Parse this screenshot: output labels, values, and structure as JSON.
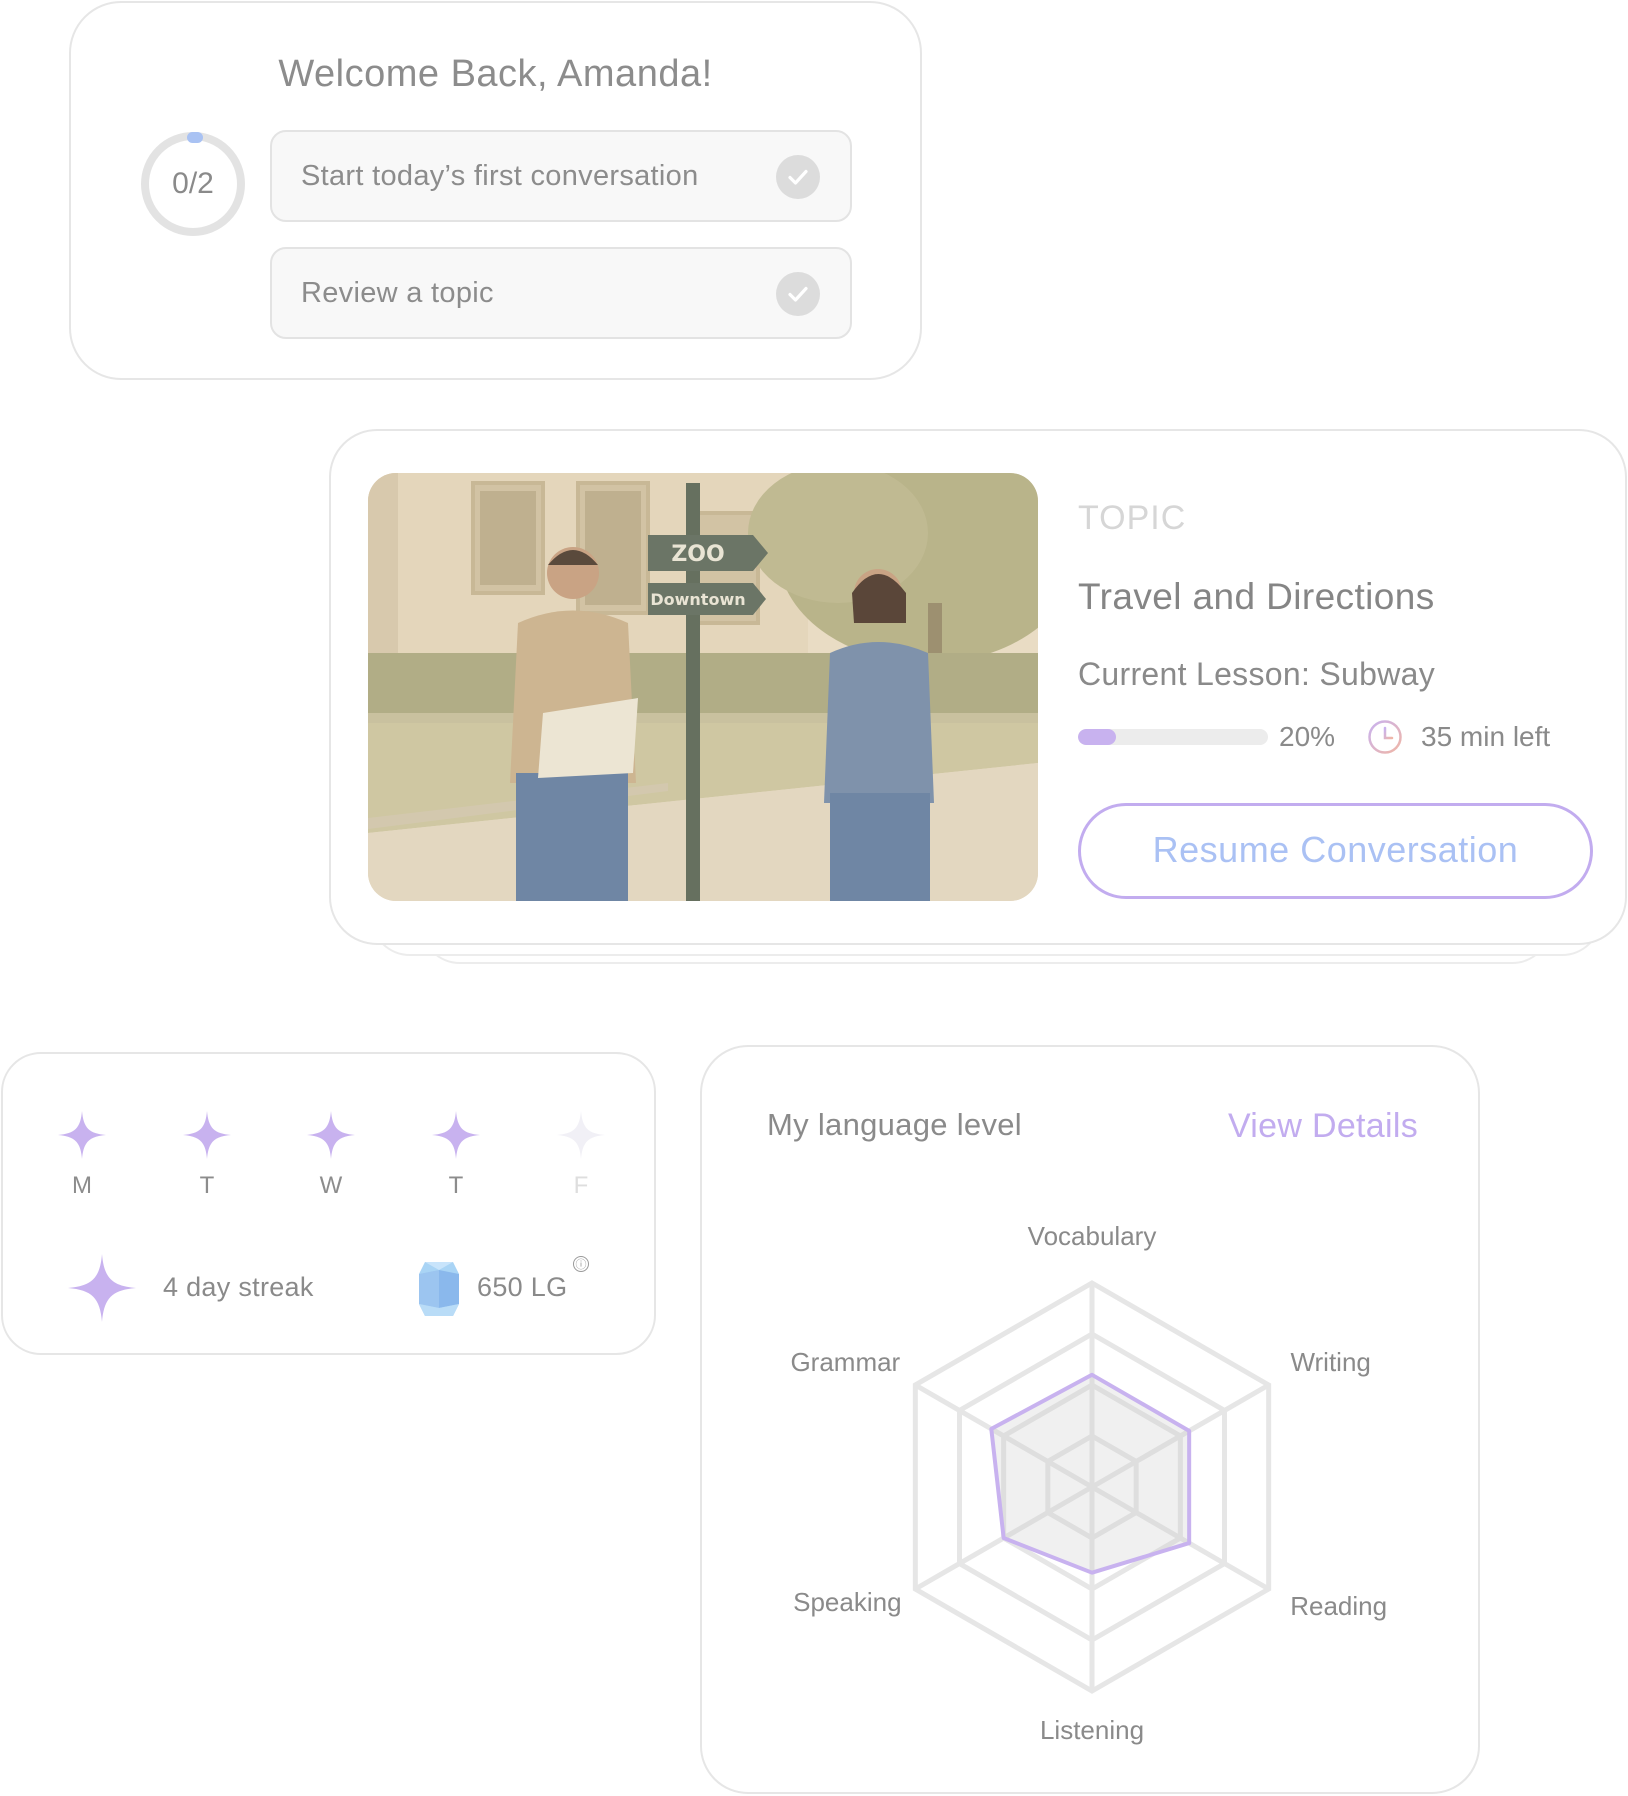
{
  "welcome": {
    "title": "Welcome Back, Amanda!",
    "progress_label": "0/2",
    "progress": {
      "completed": 0,
      "total": 2
    },
    "tasks": [
      {
        "label": "Start today’s first conversation",
        "done": false
      },
      {
        "label": "Review a topic",
        "done": false
      }
    ]
  },
  "topic": {
    "kicker": "TOPIC",
    "title": "Travel and Directions",
    "lesson": "Current Lesson: Subway",
    "progress": 0.2,
    "progress_label": "20%",
    "time_left": "35 min left",
    "resume_label": "Resume Conversation",
    "photo": {
      "sign_top": "ZOO",
      "sign_bottom": "Downtown"
    }
  },
  "streak": {
    "days": [
      {
        "label": "M",
        "active": true
      },
      {
        "label": "T",
        "active": true
      },
      {
        "label": "W",
        "active": true
      },
      {
        "label": "T",
        "active": true
      },
      {
        "label": "F",
        "active": false
      }
    ],
    "streak_text": "4 day streak",
    "points_text": "650 LG",
    "info_icon": "ⓘ"
  },
  "level": {
    "heading": "My language level",
    "details_label": "View Details",
    "chart_data": {
      "type": "radar",
      "axes": [
        "Vocabulary",
        "Writing",
        "Reading",
        "Listening",
        "Speaking",
        "Grammar"
      ],
      "values": [
        0.55,
        0.55,
        0.55,
        0.42,
        0.5,
        0.57
      ],
      "max": 1,
      "levels": 4
    }
  },
  "colors": {
    "accent_purple": "#c2acef",
    "accent_blue": "#aac1f4",
    "muted_text": "#8a8a8a",
    "border": "#e6e6e6"
  },
  "icons": {
    "check": "check-icon",
    "clock": "clock-icon",
    "star": "sparkle-star-icon",
    "gem": "gem-icon"
  }
}
